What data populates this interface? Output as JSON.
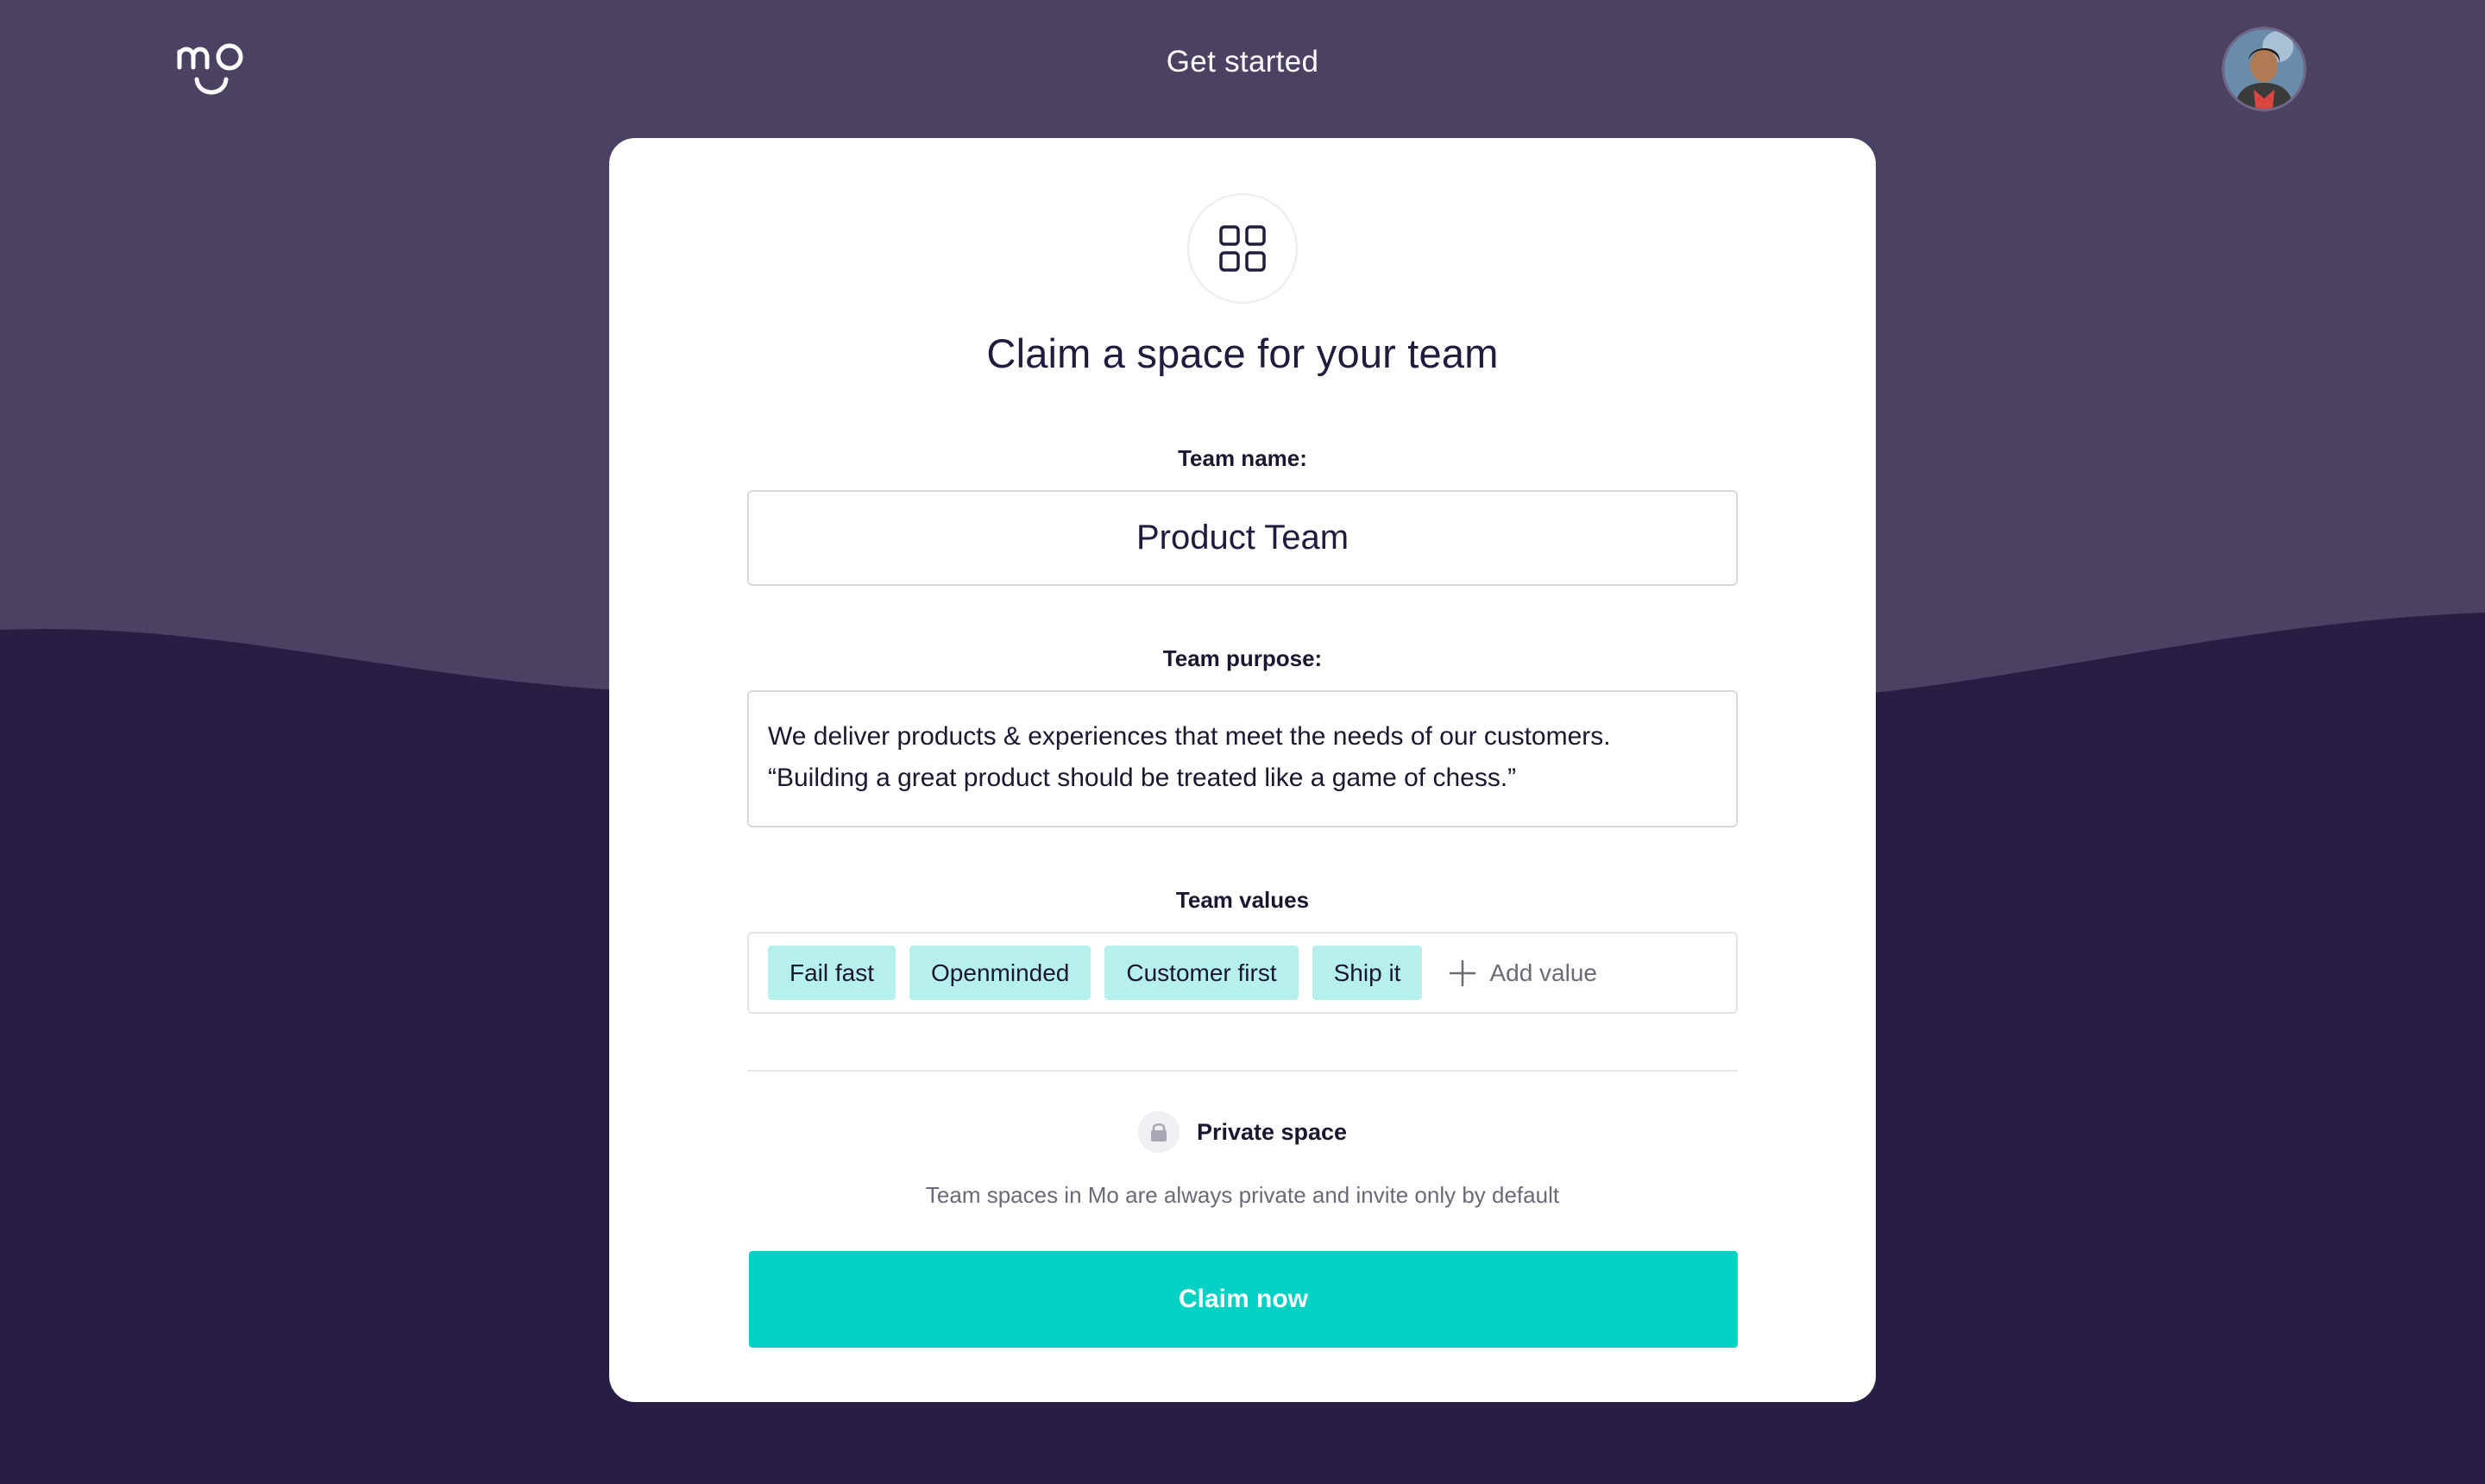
{
  "header": {
    "logo_icon": "mo-smile-logo",
    "title": "Get started",
    "avatar_icon": "user-avatar"
  },
  "card": {
    "icon": "grid-icon",
    "title": "Claim a space for your team",
    "team_name": {
      "label": "Team name:",
      "value": "Product Team"
    },
    "team_purpose": {
      "label": "Team purpose:",
      "line1": "We deliver products & experiences that meet the needs of our customers.",
      "line2": "“Building a great product should be treated like a game of chess.”"
    },
    "team_values": {
      "label": "Team values",
      "chips": [
        "Fail fast",
        "Openminded",
        "Customer first",
        "Ship it"
      ],
      "add_label": "Add value"
    },
    "privacy": {
      "icon": "lock-icon",
      "title": "Private space",
      "description": "Team spaces in Mo are always private and invite only by default"
    },
    "claim_button": "Claim now"
  },
  "colors": {
    "top_background": "#4d4163",
    "bottom_background": "#281d43",
    "accent": "#02d2c4",
    "chip_background": "#b5f0ec"
  }
}
